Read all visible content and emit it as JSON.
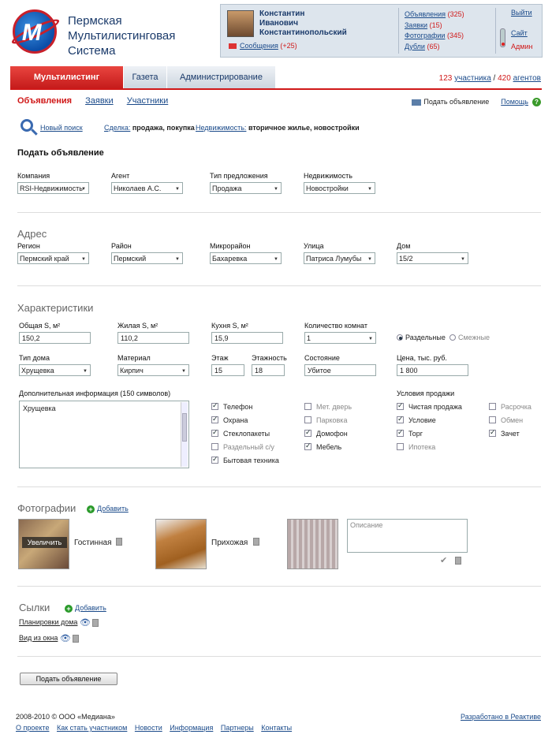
{
  "brand": {
    "line1": "Пермская",
    "line2": "Мультилистинговая",
    "line3": "Система"
  },
  "user": {
    "first": "Константин",
    "middle": "Иванович",
    "last": "Константинопольский",
    "messages_label": "Сообщения",
    "messages_count": "(+25)"
  },
  "stats": [
    {
      "label": "Объявления",
      "count": "(325)"
    },
    {
      "label": "Заявки",
      "count": "(15)"
    },
    {
      "label": "Фотографии",
      "count": "(345)"
    },
    {
      "label": "Дубли",
      "count": "(65)"
    }
  ],
  "right_links": {
    "logout": "Выйти",
    "site": "Сайт",
    "admin": "Админ"
  },
  "tabs": {
    "active": "Мультилистинг",
    "t2": "Газета",
    "t3": "Администрирование"
  },
  "members": {
    "count1": "123",
    "label1": "участника",
    "sep": "/",
    "count2": "420",
    "label2": "агентов"
  },
  "subnav": {
    "ads": "Объявления",
    "requests": "Заявки",
    "participants": "Участники"
  },
  "topright": {
    "post_ad": "Подать объявление",
    "help": "Помощь",
    "help_icon": "?"
  },
  "search": {
    "new_search": "Новый поиск",
    "deal_label": "Сделка:",
    "deal_value": "продажа, покупка",
    "estate_label": "Недвижимость:",
    "estate_value": "вторичное жилье, новостройки"
  },
  "form_title": "Подать объявление",
  "top_fields": {
    "company_label": "Компания",
    "company_value": "RSI-Недвижимость",
    "agent_label": "Агент",
    "agent_value": "Николаев А.С.",
    "offer_label": "Тип предложения",
    "offer_value": "Продажа",
    "estate_label": "Недвижимость",
    "estate_value": "Новостройки"
  },
  "address": {
    "title": "Адрес",
    "region_label": "Регион",
    "region_value": "Пермский край",
    "district_label": "Район",
    "district_value": "Пермский",
    "micro_label": "Микрорайон",
    "micro_value": "Бахаревка",
    "street_label": "Улица",
    "street_value": "Патриса Лумубы",
    "house_label": "Дом",
    "house_value": "15/2"
  },
  "chars": {
    "title": "Характеристики",
    "total_label": "Общая S, м²",
    "total_value": "150,2",
    "living_label": "Жилая S, м²",
    "living_value": "110,2",
    "kitchen_label": "Кухня S, м²",
    "kitchen_value": "15,9",
    "rooms_label": "Количество комнат",
    "rooms_value": "1",
    "sep_label": "Раздельные",
    "adj_label": "Смежные",
    "house_type_label": "Тип дома",
    "house_type_value": "Хрущевка",
    "material_label": "Материал",
    "material_value": "Кирпич",
    "floor_label": "Этаж",
    "floor_value": "15",
    "floors_label": "Этажность",
    "floors_value": "18",
    "state_label": "Состояние",
    "state_value": "Убитое",
    "price_label": "Цена, тыс. руб.",
    "price_value": "1 800",
    "extra_label": "Дополнительная информация  (150 символов)",
    "extra_value": "Хрущевка"
  },
  "features_col1": [
    {
      "label": "Телефон",
      "checked": true
    },
    {
      "label": "Охрана",
      "checked": true
    },
    {
      "label": "Стеклопакеты",
      "checked": true
    },
    {
      "label": "Раздельный с/у",
      "checked": false
    },
    {
      "label": "Бытовая техника",
      "checked": true
    }
  ],
  "features_col2": [
    {
      "label": "Мет. дверь",
      "checked": false
    },
    {
      "label": "Парковка",
      "checked": false
    },
    {
      "label": "Домофон",
      "checked": true
    },
    {
      "label": "Мебель",
      "checked": true
    }
  ],
  "sale_conditions": {
    "title": "Условия продажи",
    "col1": [
      {
        "label": "Чистая продажа",
        "checked": true
      },
      {
        "label": "Условие",
        "checked": true
      },
      {
        "label": "Торг",
        "checked": true
      },
      {
        "label": "Ипотека",
        "checked": false
      }
    ],
    "col2": [
      {
        "label": "Расрочка",
        "checked": false
      },
      {
        "label": "Обмен",
        "checked": false
      },
      {
        "label": "Зачет",
        "checked": true
      }
    ]
  },
  "photos": {
    "title": "Фотографии",
    "add": "Добавить",
    "items": [
      {
        "caption": "Гостинная",
        "overlay": "Увеличить"
      },
      {
        "caption": "Прихожая"
      }
    ],
    "desc_placeholder": "Описание"
  },
  "links": {
    "title": "Сылки",
    "add": "Добавить",
    "items": [
      "Планировки дома",
      "Вид из окна"
    ]
  },
  "submit": "Подать объявление",
  "footer": {
    "copyright": "2008-2010 © ООО «Медиана»",
    "links": [
      "О проекте",
      "Как стать участником",
      "Новости",
      "Информация",
      "Партнеры",
      "Контакты"
    ],
    "dev": "Разработано в  Реактиве"
  }
}
